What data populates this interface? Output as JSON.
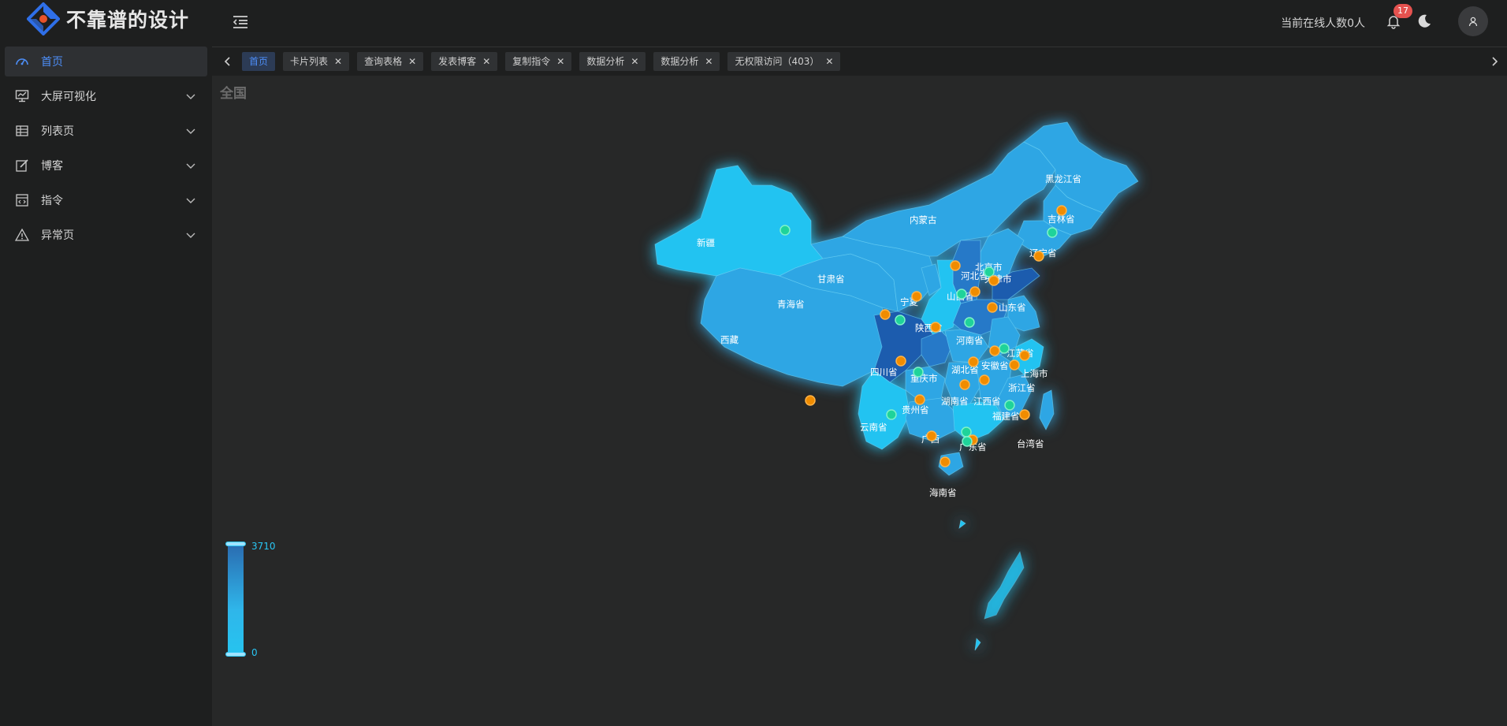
{
  "app": {
    "logo_text": "不靠谱的设计"
  },
  "sidebar": {
    "items": [
      {
        "label": "首页",
        "icon": "dashboard-icon",
        "active": true
      },
      {
        "label": "大屏可视化",
        "icon": "screen-chart-icon",
        "expandable": true
      },
      {
        "label": "列表页",
        "icon": "table-icon",
        "expandable": true
      },
      {
        "label": "博客",
        "icon": "edit-icon",
        "expandable": true
      },
      {
        "label": "指令",
        "icon": "code-window-icon",
        "expandable": true
      },
      {
        "label": "异常页",
        "icon": "warning-icon",
        "expandable": true
      }
    ]
  },
  "header": {
    "online_text": "当前在线人数0人",
    "notification_count": "17"
  },
  "tabs": [
    {
      "label": "首页",
      "active": true
    },
    {
      "label": "卡片列表"
    },
    {
      "label": "查询表格"
    },
    {
      "label": "发表博客"
    },
    {
      "label": "复制指令"
    },
    {
      "label": "数据分析"
    },
    {
      "label": "数据分析"
    },
    {
      "label": "无权限访问（403）"
    }
  ],
  "map": {
    "region_title": "全国",
    "legend": {
      "max": "3710",
      "min": "0"
    },
    "province_labels": [
      "新疆",
      "西藏",
      "青海省",
      "甘肃省",
      "内蒙古",
      "黑龙江省",
      "吉林省",
      "辽宁省",
      "北京市",
      "河北省",
      "天津市",
      "山西省",
      "山东省",
      "宁夏",
      "陕西省",
      "河南省",
      "江苏省",
      "安徽省",
      "上海市",
      "四川省",
      "重庆市",
      "湖北省",
      "浙江省",
      "湖南省",
      "江西省",
      "贵州省",
      "云南省",
      "广西",
      "广东省",
      "福建省",
      "台湾省",
      "海南省"
    ],
    "colors": {
      "light": "#24c3f1",
      "mid": "#2da6e4",
      "dark": "#2579c8",
      "darkest": "#1c5cae",
      "marker_orange": "#f08c00",
      "marker_green": "#1fd39a"
    }
  }
}
